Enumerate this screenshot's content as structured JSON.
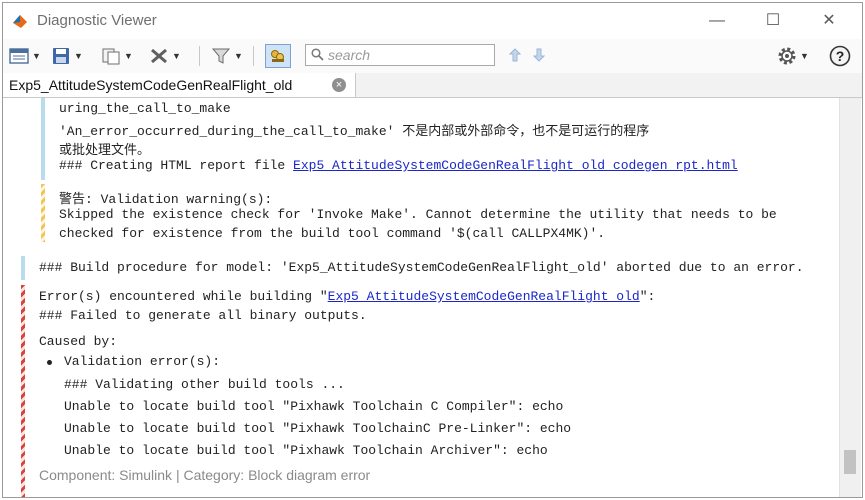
{
  "window": {
    "title": "Diagnostic Viewer",
    "controls": {
      "minimize": "—",
      "maximize": "☐",
      "close": "✕"
    }
  },
  "toolbar": {
    "search": {
      "placeholder": "search",
      "value": ""
    },
    "icons": [
      "view-icon",
      "save-icon",
      "copy-icon",
      "clear-icon",
      "filter-icon",
      "group-icon",
      "search-icon",
      "up-arrow-icon",
      "down-arrow-icon",
      "settings-icon",
      "help-icon"
    ],
    "help_label": "?"
  },
  "tab": {
    "label": "Exp5_AttitudeSystemCodeGenRealFlight_old",
    "close": "×"
  },
  "messages": {
    "info1": {
      "line1": "uring_the_call_to_make",
      "line2": "'An_error_occurred_during_the_call_to_make' 不是内部或外部命令，也不是可运行的程序",
      "line3": "或批处理文件。",
      "line4_prefix": "### Creating HTML report file ",
      "line4_link": "Exp5_AttitudeSystemCodeGenRealFlight_old_codegen_rpt.html"
    },
    "warning": {
      "line1": "警告: Validation warning(s):",
      "line2": "Skipped the existence check for 'Invoke Make'. Cannot determine the utility that needs to be",
      "line3": "checked for existence from the build tool command '$(call CALLPX4MK)'."
    },
    "info2": {
      "line1": "### Build procedure for model: 'Exp5_AttitudeSystemCodeGenRealFlight_old' aborted due to an error."
    },
    "error": {
      "line1_prefix": "Error(s) encountered while building \"",
      "line1_link": "Exp5_AttitudeSystemCodeGenRealFlight_old",
      "line1_suffix": "\":",
      "line2": "### Failed to generate all binary outputs.",
      "caused_by": "Caused by:",
      "bullet": "Validation error(s):",
      "details": [
        "### Validating other build tools ...",
        "Unable to locate build tool \"Pixhawk Toolchain C Compiler\": echo",
        "Unable to locate build tool \"Pixhawk ToolchainC Pre-Linker\": echo",
        "Unable to locate build tool \"Pixhawk Toolchain Archiver\": echo"
      ],
      "component": "Component: Simulink | Category: Block diagram error"
    }
  },
  "colors": {
    "info_bar": "#b8dcec",
    "warning_bar": "#f3c45a",
    "error_bar": "#d6453d",
    "link": "#1b27c8"
  }
}
